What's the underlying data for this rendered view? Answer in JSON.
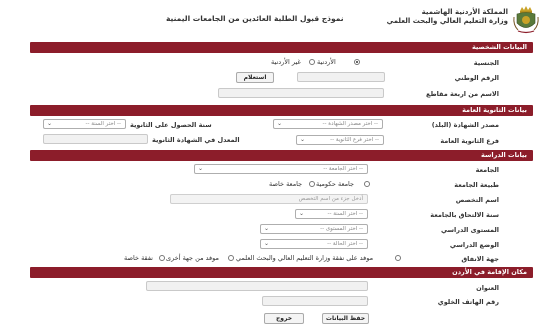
{
  "header": {
    "org_line1": "المملكة الأردنية الهاشمية",
    "org_line2": "وزارة التعليم العالي والبحث العلمي",
    "page_title": "نموذج قبول الطلبة العائدين من الجامعات اليمنية"
  },
  "personal": {
    "section_title": "البيانات الشخصية",
    "nationality_label": "الجنسية",
    "nationality_options": [
      "الأردنية",
      "غير الأردنية"
    ],
    "national_id_label": "الرقم الوطني",
    "query_button": "استعلام",
    "fullname_label": "الاسم من اربعة مقاطع"
  },
  "secondary": {
    "section_title": "بيانات الثانوية العامة",
    "cert_source_label": "مصدر الشهادة (البلد)",
    "cert_source_placeholder": "-- اختر مصدر الشهادة --",
    "year_label": "سنة الحصول على الثانوية",
    "year_placeholder": "-- اختر السنة --",
    "branch_label": "فرع الثانوية العامة",
    "branch_placeholder": "-- اختر فرع الثانوية --",
    "average_label": "المعدل في الشهادة الثانوية"
  },
  "study": {
    "section_title": "بيانات الدراسة",
    "university_label": "الجامعة",
    "university_placeholder": "-- اختر الجامعة --",
    "univ_type_label": "طبيعة الجامعة",
    "univ_type_options": [
      "جامعة حكومية",
      "جامعة خاصة"
    ],
    "major_label": "اسم التخصص",
    "major_placeholder": "أدخل جزء من اسم التخصص",
    "enroll_year_label": "سنة الالتحاق بالجامعة",
    "enroll_year_placeholder": "-- اختر السنة --",
    "level_label": "المستوى الدراسي",
    "level_placeholder": "-- اختر المستوى --",
    "status_label": "الوضع الدراسي",
    "status_placeholder": "-- اختر الحالة --",
    "funding_label": "جهة الانفاق",
    "funding_options": [
      "موفد على نفقة وزارة التعليم العالي والبحث العلمي",
      "موفد من جهة أخرى",
      "نفقة خاصة"
    ]
  },
  "residence": {
    "section_title": "مكان الإقامة في الأردن",
    "address_label": "العنوان",
    "mobile_label": "رقم الهاتف الخلوي"
  },
  "actions": {
    "save_label": "حفظ البيانات",
    "exit_label": "خروج"
  },
  "colors": {
    "section_bar": "#8c1d2a"
  }
}
